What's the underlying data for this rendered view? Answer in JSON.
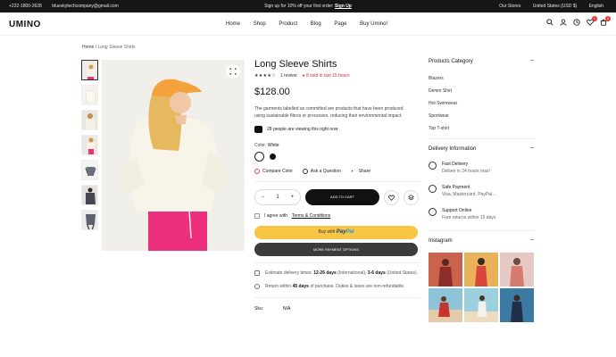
{
  "topbar": {
    "phone": "+222-1800-2628",
    "email": "blueskytechcompany@gmail.com",
    "promo": "Sign up for 10% off your first order:",
    "promo_link": "Sign Up",
    "our_store": "Our Stores",
    "currency": "United States (USD $)",
    "language": "English"
  },
  "header": {
    "logo": "UMINO",
    "nav": [
      "Home",
      "Shop",
      "Product",
      "Blog",
      "Page",
      "Buy Umino!"
    ],
    "wishlist_count": "1",
    "cart_count": "0"
  },
  "breadcrumb": {
    "home": "Home",
    "current": "Long Sleeve Shirts"
  },
  "product": {
    "title": "Long Sleeve Shirts",
    "stars": "★★★★☆",
    "reviews": "1 review",
    "sold": "8 sold in last 15 hours",
    "price": "$128.00",
    "description": "The garments labelled as committed are products that have been produced using sustainable fibres or processes, reducing their environmental impact.",
    "viewing": "28 people are viewing this right now",
    "color_label": "Color:",
    "color_value": "White",
    "compare": "Compare Color",
    "ask": "Ask a Question",
    "share": "Share",
    "qty": "1",
    "add_to_cart": "ADD TO CART",
    "agree_prefix": "I agree with",
    "agree_link": "Terms & Conditions",
    "buy_with": "Buy with",
    "paypal_1": "Pay",
    "paypal_2": "Pal",
    "more_payment": "MORE PAYMENT OPTIONS",
    "delivery_prefix": "Estimate delivery times:",
    "delivery_intl": "12-26 days",
    "delivery_mid": "(International),",
    "delivery_us": "3-6 days",
    "delivery_suffix": "(United States).",
    "return_prefix": "Return within",
    "return_days": "45 days",
    "return_suffix": "of purchase. Duties & taxes are non-refundable.",
    "sku_label": "Sku:",
    "sku_value": "N/A"
  },
  "sidebar": {
    "categories_title": "Products Category",
    "categories": [
      "Blazers",
      "Denim Shirt",
      "Hot Swimwear",
      "Sportwear",
      "Top T-shirt"
    ],
    "delivery_title": "Delivery Information",
    "delivery": [
      {
        "title": "Fast Delivery",
        "sub": "Deliver in 24 hours max!"
      },
      {
        "title": "Safe Payment",
        "sub": "Visa, Mastercard, PayPal..."
      },
      {
        "title": "Support Online",
        "sub": "Free returns within 15 days"
      }
    ],
    "instagram_title": "Instagram"
  },
  "colors": {
    "accent_red": "#d6302a",
    "paypal_yellow": "#f8c545",
    "dark": "#111111"
  }
}
